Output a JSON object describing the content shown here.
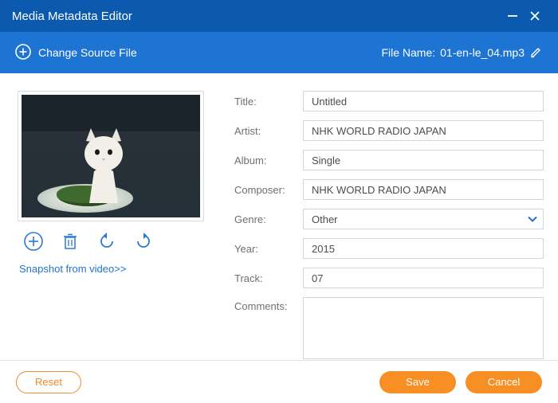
{
  "window": {
    "title": "Media Metadata Editor"
  },
  "header": {
    "change_source": "Change Source File",
    "file_name_label": "File Name:",
    "file_name_value": "01-en-le_04.mp3"
  },
  "art": {
    "snapshot_link": "Snapshot from video>>"
  },
  "fields": {
    "title_label": "Title:",
    "title_value": "Untitled",
    "artist_label": "Artist:",
    "artist_value": "NHK WORLD RADIO JAPAN",
    "album_label": "Album:",
    "album_value": "Single",
    "composer_label": "Composer:",
    "composer_value": "NHK WORLD RADIO JAPAN",
    "genre_label": "Genre:",
    "genre_value": "Other",
    "year_label": "Year:",
    "year_value": "2015",
    "track_label": "Track:",
    "track_value": "07",
    "comments_label": "Comments:",
    "comments_value": ""
  },
  "footer": {
    "reset": "Reset",
    "save": "Save",
    "cancel": "Cancel"
  },
  "colors": {
    "titlebar": "#0b5ab0",
    "header": "#1e74d2",
    "accent": "#f78f24",
    "icon": "#2d78cf"
  }
}
